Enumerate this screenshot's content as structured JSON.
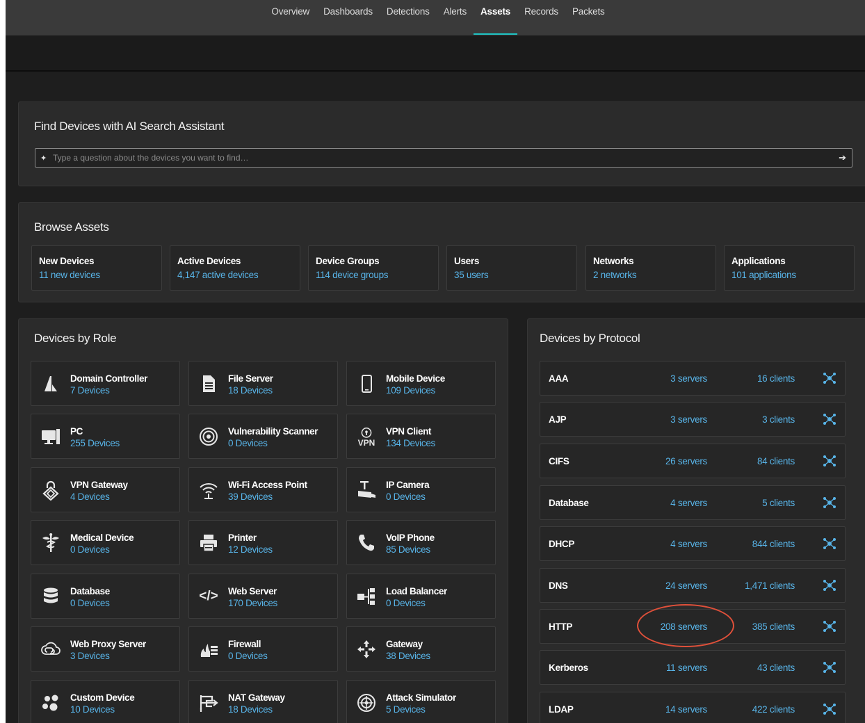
{
  "nav": {
    "tabs": [
      {
        "label": "Overview"
      },
      {
        "label": "Dashboards"
      },
      {
        "label": "Detections"
      },
      {
        "label": "Alerts"
      },
      {
        "label": "Assets",
        "active": true
      },
      {
        "label": "Records"
      },
      {
        "label": "Packets"
      }
    ]
  },
  "search": {
    "title": "Find Devices with AI Search Assistant",
    "placeholder": "Type a question about the devices you want to find…"
  },
  "browse": {
    "title": "Browse Assets",
    "cards": [
      {
        "title": "New Devices",
        "sub": "11 new devices"
      },
      {
        "title": "Active Devices",
        "sub": "4,147 active devices"
      },
      {
        "title": "Device Groups",
        "sub": "114 device groups"
      },
      {
        "title": "Users",
        "sub": "35 users"
      },
      {
        "title": "Networks",
        "sub": "2 networks"
      },
      {
        "title": "Applications",
        "sub": "101 applications"
      }
    ]
  },
  "roles": {
    "title": "Devices by Role",
    "items": [
      {
        "title": "Domain Controller",
        "sub": "7 Devices",
        "icon": "domain-controller-icon"
      },
      {
        "title": "File Server",
        "sub": "18 Devices",
        "icon": "file-server-icon"
      },
      {
        "title": "Mobile Device",
        "sub": "109 Devices",
        "icon": "mobile-device-icon"
      },
      {
        "title": "PC",
        "sub": "255 Devices",
        "icon": "pc-icon"
      },
      {
        "title": "Vulnerability Scanner",
        "sub": "0 Devices",
        "icon": "vulnerability-scanner-icon"
      },
      {
        "title": "VPN Client",
        "sub": "134 Devices",
        "icon": "vpn-client-icon",
        "icon_text": "VPN"
      },
      {
        "title": "VPN Gateway",
        "sub": "4 Devices",
        "icon": "vpn-gateway-icon"
      },
      {
        "title": "Wi-Fi Access Point",
        "sub": "39 Devices",
        "icon": "wifi-icon"
      },
      {
        "title": "IP Camera",
        "sub": "0 Devices",
        "icon": "ip-camera-icon"
      },
      {
        "title": "Medical Device",
        "sub": "0 Devices",
        "icon": "medical-icon"
      },
      {
        "title": "Printer",
        "sub": "12 Devices",
        "icon": "printer-icon"
      },
      {
        "title": "VoIP Phone",
        "sub": "85 Devices",
        "icon": "phone-icon"
      },
      {
        "title": "Database",
        "sub": "0 Devices",
        "icon": "database-icon"
      },
      {
        "title": "Web Server",
        "sub": "170 Devices",
        "icon": "code-icon",
        "icon_text": "</>"
      },
      {
        "title": "Load Balancer",
        "sub": "0 Devices",
        "icon": "load-balancer-icon"
      },
      {
        "title": "Web Proxy Server",
        "sub": "3 Devices",
        "icon": "web-proxy-icon"
      },
      {
        "title": "Firewall",
        "sub": "0 Devices",
        "icon": "firewall-icon"
      },
      {
        "title": "Gateway",
        "sub": "38 Devices",
        "icon": "gateway-icon"
      },
      {
        "title": "Custom Device",
        "sub": "10 Devices",
        "icon": "custom-device-icon"
      },
      {
        "title": "NAT Gateway",
        "sub": "18 Devices",
        "icon": "nat-gateway-icon"
      },
      {
        "title": "Attack Simulator",
        "sub": "5 Devices",
        "icon": "attack-simulator-icon"
      }
    ]
  },
  "protocols": {
    "title": "Devices by Protocol",
    "rows": [
      {
        "name": "AAA",
        "servers": "3 servers",
        "clients": "16 clients"
      },
      {
        "name": "AJP",
        "servers": "3 servers",
        "clients": "3 clients"
      },
      {
        "name": "CIFS",
        "servers": "26 servers",
        "clients": "84 clients"
      },
      {
        "name": "Database",
        "servers": "4 servers",
        "clients": "5 clients"
      },
      {
        "name": "DHCP",
        "servers": "4 servers",
        "clients": "844 clients"
      },
      {
        "name": "DNS",
        "servers": "24 servers",
        "clients": "1,471 clients"
      },
      {
        "name": "HTTP",
        "servers": "208 servers",
        "clients": "385 clients",
        "highlighted": true
      },
      {
        "name": "Kerberos",
        "servers": "11 servers",
        "clients": "43 clients"
      },
      {
        "name": "LDAP",
        "servers": "14 servers",
        "clients": "422 clients"
      }
    ]
  },
  "colors": {
    "accent": "#1fc4c4",
    "link": "#58b4e8",
    "highlight": "#e0503a"
  }
}
